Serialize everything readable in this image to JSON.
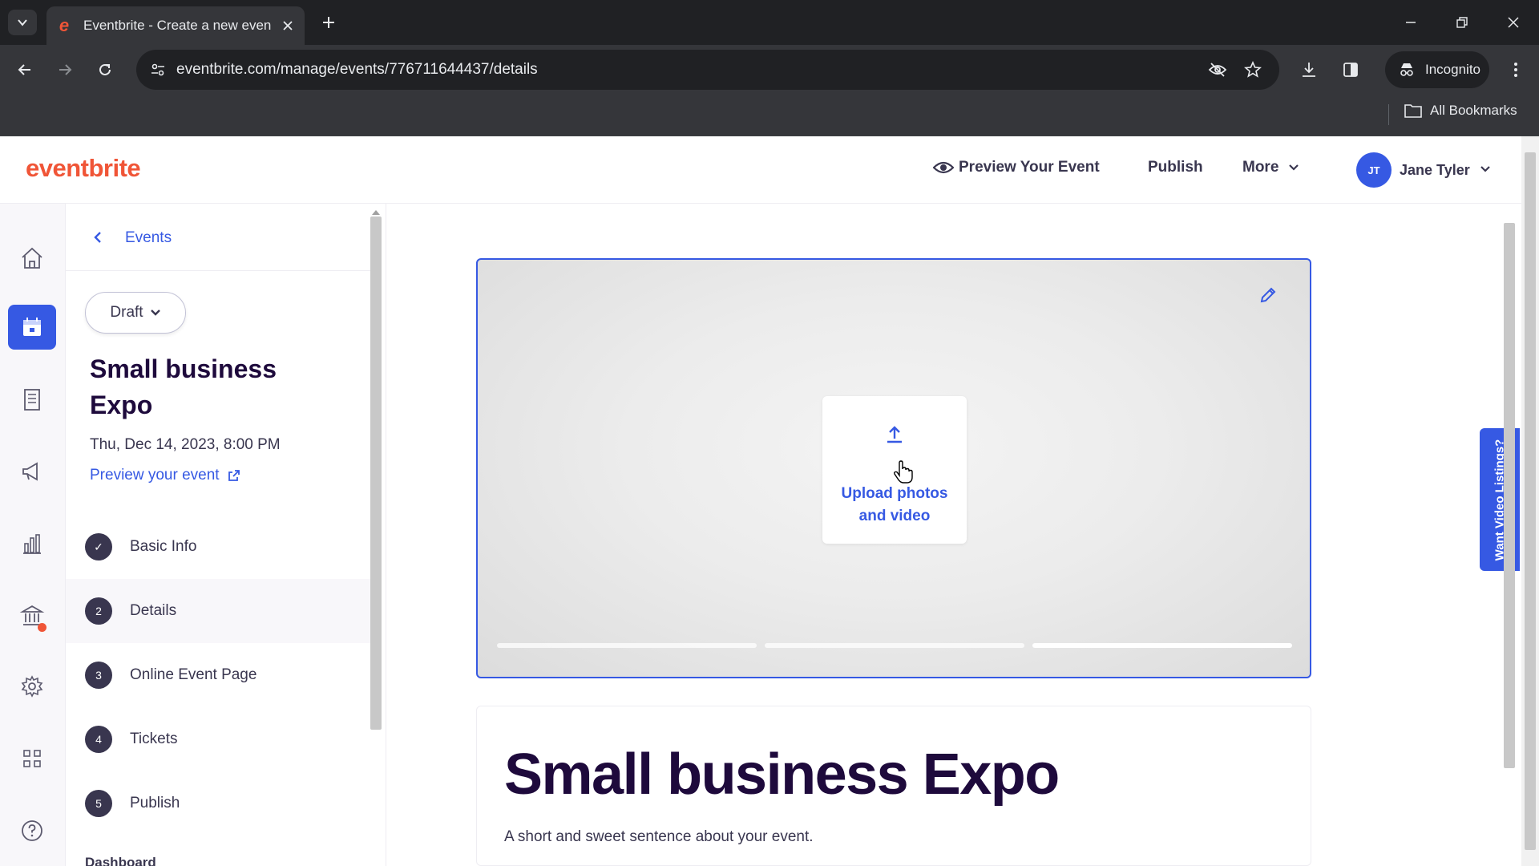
{
  "browser": {
    "tab_title": "Eventbrite - Create a new even",
    "url": "eventbrite.com/manage/events/776711644437/details",
    "incognito_label": "Incognito",
    "bookmarks_label": "All Bookmarks"
  },
  "header": {
    "logo": "eventbrite",
    "preview_label": "Preview Your Event",
    "publish_label": "Publish",
    "more_label": "More",
    "user_initials": "JT",
    "user_name": "Jane Tyler"
  },
  "rail": {
    "items": [
      "home-icon",
      "calendar-icon",
      "orders-icon",
      "marketing-icon",
      "reports-icon",
      "finance-icon",
      "settings-icon",
      "apps-icon",
      "help-icon"
    ],
    "active": "calendar-icon",
    "accent": "#3659e3"
  },
  "panel": {
    "back_label": "Events",
    "status": "Draft",
    "event_title": "Small business Expo",
    "event_date": "Thu, Dec 14, 2023, 8:00 PM",
    "preview_link": "Preview your event",
    "steps": [
      {
        "badge": "✓",
        "label": "Basic Info",
        "done": true
      },
      {
        "badge": "2",
        "label": "Details",
        "current": true
      },
      {
        "badge": "3",
        "label": "Online Event Page"
      },
      {
        "badge": "4",
        "label": "Tickets"
      },
      {
        "badge": "5",
        "label": "Publish"
      }
    ],
    "footer_label": "Dashboard"
  },
  "main": {
    "upload_label_line1": "Upload photos",
    "upload_label_line2": "and video",
    "event_title": "Small business Expo",
    "summary_placeholder": "A short and sweet sentence about your event.",
    "side_tab_label": "Want Video Listings?"
  },
  "colors": {
    "brand": "#f05537",
    "accent": "#3659e3",
    "text_dark": "#1e0a3c",
    "text_body": "#39364f"
  }
}
